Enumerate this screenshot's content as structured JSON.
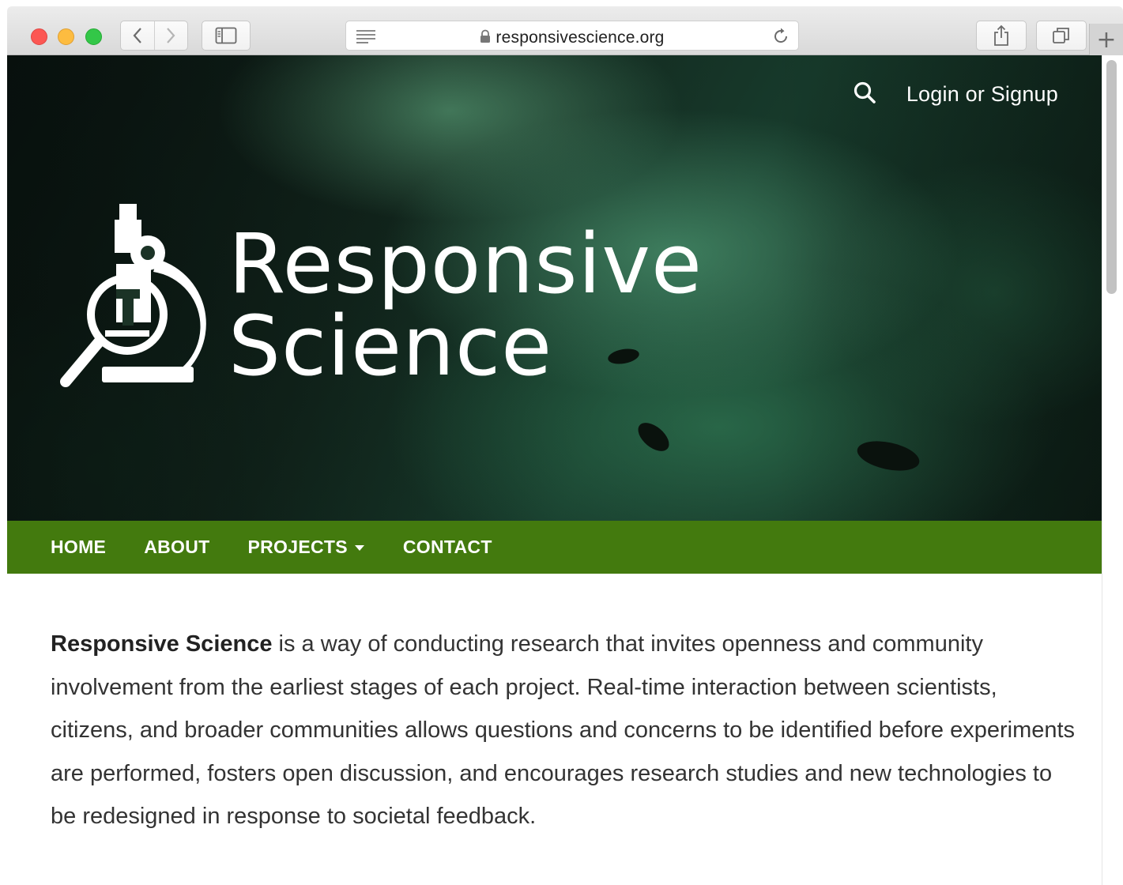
{
  "browser": {
    "url": "responsivescience.org",
    "new_tab_label": "+"
  },
  "hero": {
    "login_label": "Login or Signup",
    "logo_line1": "Responsive",
    "logo_line2": "Science"
  },
  "nav": {
    "items": [
      "HOME",
      "ABOUT",
      "PROJECTS",
      "CONTACT"
    ]
  },
  "content": {
    "lead_bold": "Responsive Science",
    "lead_rest": " is a way of conducting research that invites openness and community involvement from the earliest stages of each project. Real-time interaction between scientists, citizens, and broader communities allows questions and concerns to be identified before experiments are performed, fosters open discussion, and encourages research studies and new technologies to be redesigned in response to societal feedback."
  },
  "colors": {
    "nav_green": "#437a0e",
    "text": "#333333"
  }
}
